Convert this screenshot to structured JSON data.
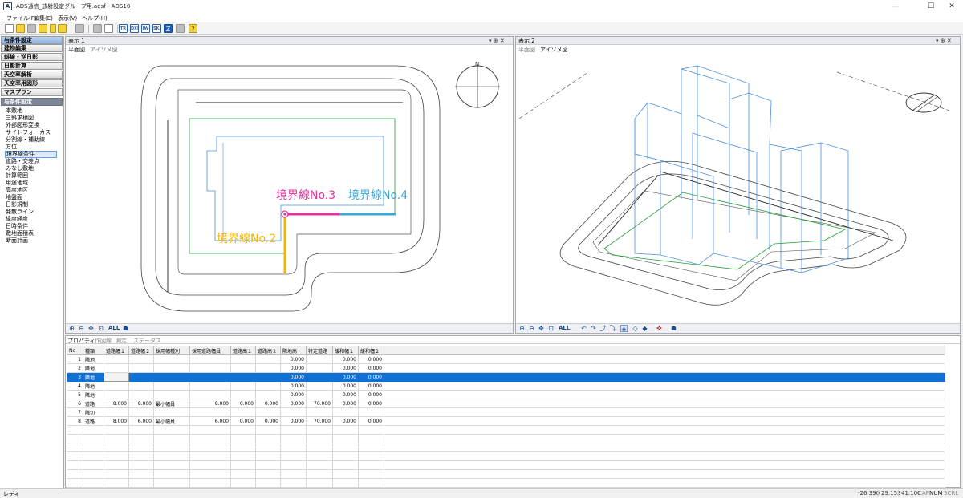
{
  "window": {
    "app_icon_letter": "A",
    "title": "ADS通信_放射設定グループ用.adsf - ADS10",
    "minimize": "—",
    "maximize": "☐",
    "close": "✕"
  },
  "menu": [
    "ファイル(F)",
    "編集(E)",
    "表示(V)",
    "ヘルプ(H)"
  ],
  "toolbar": {
    "btn_tr": "TR",
    "btn_dxf": "DXF",
    "btn_jw": "JW",
    "btn_skp": "SKP",
    "btn_z": "Z",
    "btn_help": "?"
  },
  "sidebar": {
    "sections": [
      "与条件設定",
      "建物編集",
      "斜線・逆日影",
      "日影計算",
      "天空率解析",
      "天空率用図形",
      "マスプラン"
    ],
    "active_section": "与条件設定",
    "items": [
      "本敷地",
      "三斜求積図",
      "外部図形変換",
      "サイトフォーカス",
      "分割線・補助線",
      "方位",
      "境界線条件",
      "道路・交差点",
      "みなし敷地",
      "計算範囲",
      "用途地域",
      "高度地区",
      "地盤面",
      "日影規制",
      "発散ライン",
      "緯度経度",
      "日時条件",
      "敷地面積表",
      "断面計画"
    ],
    "selected_item": "境界線条件"
  },
  "view1": {
    "title": "表示 1",
    "tabs": [
      "平面図",
      "アイソメ図"
    ],
    "active_tab": "平面図",
    "label_no2": "境界線No.2",
    "label_no3": "境界線No.3",
    "label_no4": "境界線No.4",
    "compass_n": "N",
    "zoom_all": "ALL"
  },
  "view2": {
    "title": "表示 2",
    "tabs": [
      "平面図",
      "アイソメ図"
    ],
    "active_tab": "アイソメ図",
    "zoom_all": "ALL"
  },
  "pane_controls": "▾ ⊕ ✕",
  "colors": {
    "boundary_no2": "#f4b400",
    "boundary_no3": "#e0349c",
    "boundary_no4": "#3ea6d6",
    "site_line": "#1e9e2e",
    "building": "#4a8fe0",
    "selection": "#1070d4"
  },
  "grid": {
    "tabs": [
      "プロパティ",
      "作図線",
      "測定",
      "ステータス"
    ],
    "active_tab": "プロパティ",
    "columns": [
      "No",
      "種類",
      "道路幅１",
      "道路幅２",
      "採用幅種別",
      "採用道路幅員",
      "道路高１",
      "道路高２",
      "隣地高",
      "特定道路",
      "緩和幅１",
      "緩和幅２"
    ],
    "rows": [
      [
        "1",
        "隣地",
        "",
        "",
        "",
        "",
        "",
        "",
        "0.000",
        "",
        "0.000",
        "0.000"
      ],
      [
        "2",
        "隣地",
        "",
        "",
        "",
        "",
        "",
        "",
        "0.000",
        "",
        "0.000",
        "0.000"
      ],
      [
        "3",
        "隣地",
        "",
        "",
        "",
        "",
        "",
        "",
        "0.000",
        "",
        "0.000",
        "0.000"
      ],
      [
        "4",
        "隣地",
        "",
        "",
        "",
        "",
        "",
        "",
        "0.000",
        "",
        "0.000",
        "0.000"
      ],
      [
        "5",
        "隣地",
        "",
        "",
        "",
        "",
        "",
        "",
        "0.000",
        "",
        "0.000",
        "0.000"
      ],
      [
        "6",
        "道路",
        "8.000",
        "8.000",
        "最小幅員",
        "8.000",
        "0.000",
        "0.000",
        "0.000",
        "70.000",
        "0.000",
        "0.000"
      ],
      [
        "7",
        "隣切",
        "",
        "",
        "",
        "",
        "",
        "",
        "",
        "",
        "",
        ""
      ],
      [
        "8",
        "道路",
        "8.000",
        "6.000",
        "最小幅員",
        "6.000",
        "0.000",
        "0.000",
        "0.000",
        "70.000",
        "0.000",
        "0.000"
      ]
    ],
    "selected_row": 3
  },
  "status": {
    "ready": "レディ",
    "x": "-26.390",
    "y": "29.153",
    "z": "41.100",
    "cap": "CAP",
    "num": "NUM",
    "scrl": "SCRL"
  }
}
